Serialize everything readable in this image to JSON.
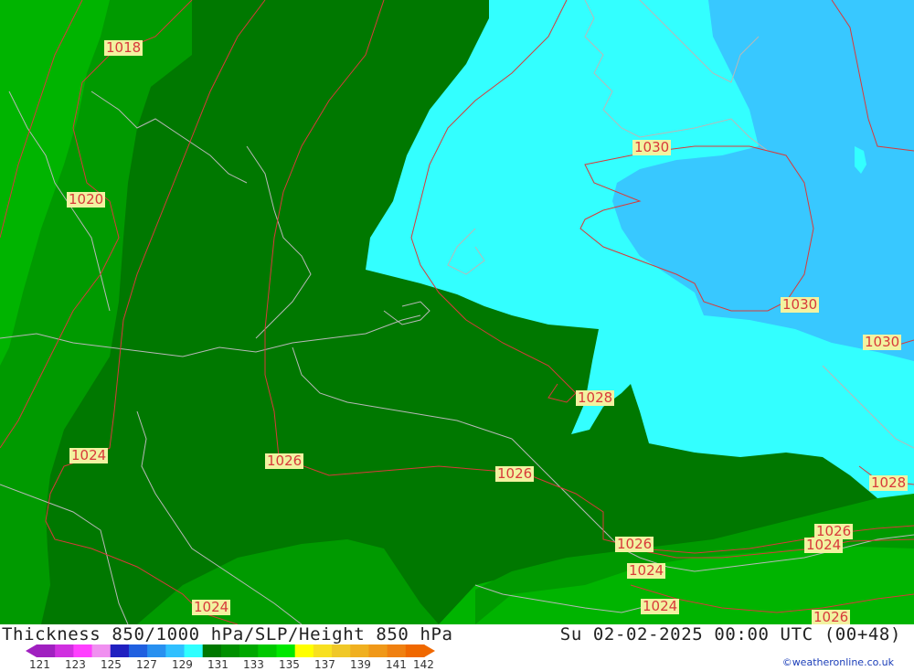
{
  "title": "Thickness 850/1000 hPa/SLP/Height 850 hPa",
  "datetime": "Su 02-02-2025 00:00 UTC (00+48)",
  "credit": "©weatheronline.co.uk",
  "colors": {
    "cyan": "#33ffff",
    "lightblue": "#38c8ff",
    "darkgreen": "#007800",
    "midgreen": "#009a00",
    "green": "#00b400",
    "isobar": "#d83a3a",
    "coast": "#b8b8b8",
    "label_bg": "#f2f2a0"
  },
  "legend": {
    "ticks": [
      "121",
      "123",
      "125",
      "127",
      "129",
      "131",
      "133",
      "135",
      "137",
      "139",
      "141",
      "142"
    ],
    "swatches": [
      "#a020c0",
      "#d030e0",
      "#ff40ff",
      "#f090f0",
      "#2020c0",
      "#2060e0",
      "#2890f0",
      "#30c0ff",
      "#30ffff",
      "#007800",
      "#009000",
      "#00a800",
      "#00c800",
      "#00e800",
      "#ffff00",
      "#f8e020",
      "#f0c828",
      "#f0b020",
      "#f09818",
      "#f08010",
      "#f06800"
    ]
  },
  "isobar_labels": [
    "1018",
    "1020",
    "1024",
    "1024",
    "1026",
    "1026",
    "1028",
    "1030",
    "1030",
    "1030",
    "1028",
    "1026",
    "1024",
    "1026",
    "1024",
    "1024",
    "1026"
  ]
}
